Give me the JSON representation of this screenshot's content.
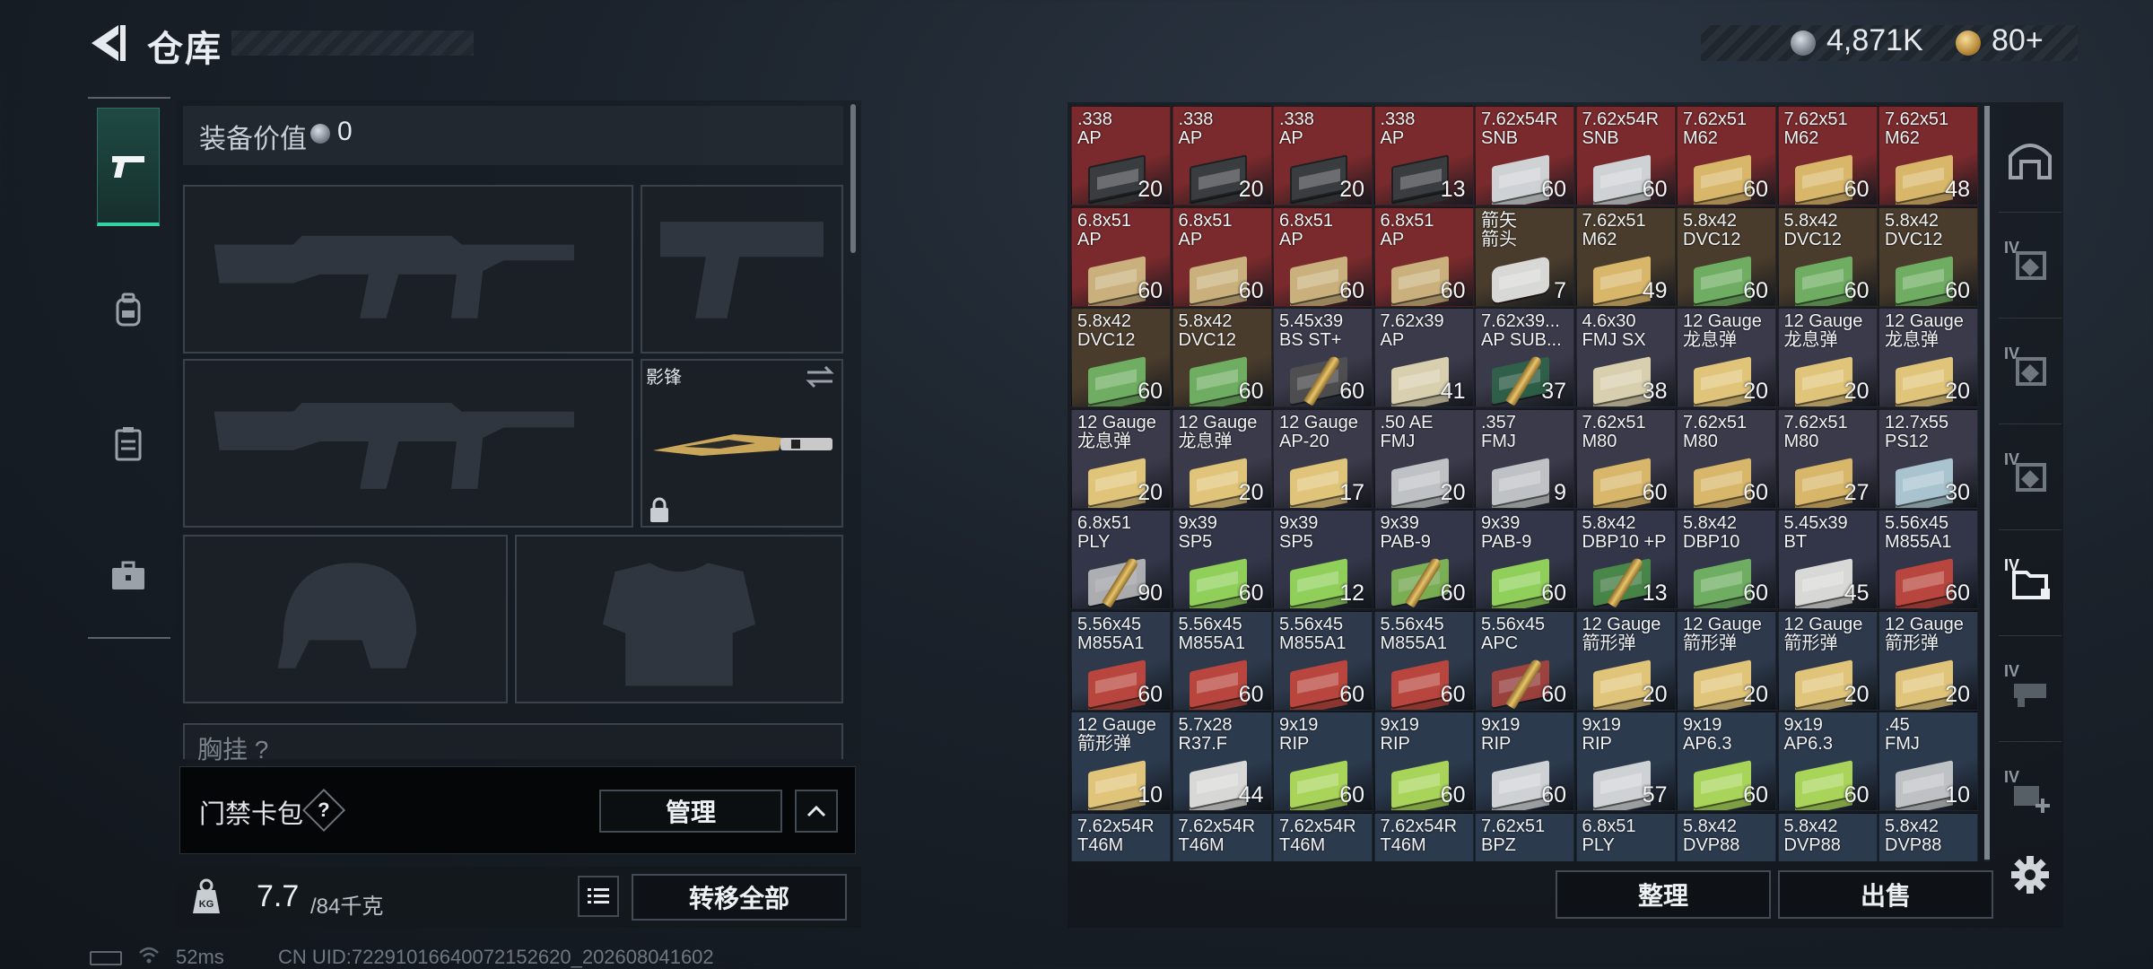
{
  "header": {
    "title": "仓库",
    "currencies": [
      {
        "name": "silver-coin-icon",
        "value": "4,871K"
      },
      {
        "name": "gold-coin-icon",
        "value": "80+"
      }
    ]
  },
  "loadout": {
    "value_label": "装备价值",
    "value": "0",
    "melee_name": "影锋",
    "chest_label": "胸挂 ?",
    "tabs": [
      "weapons-tab",
      "backpack-tab",
      "vest-tab",
      "case-tab"
    ]
  },
  "keycard": {
    "label": "门禁卡包",
    "help": "?",
    "manage": "管理"
  },
  "capacity": {
    "weight": "7.7",
    "max": "/84千克",
    "transfer_all": "转移全部",
    "weight_icon_label": "KG"
  },
  "status": {
    "ping": "52ms",
    "uid": "CN UID:72291016640072152620_202608041602"
  },
  "inventory": {
    "sort": "整理",
    "sell": "出售",
    "right_tabs": [
      "inventory-top-icon",
      "IV",
      "IV",
      "IV",
      "IV",
      "IV",
      "IV"
    ],
    "items": [
      {
        "n": ".338\nAP",
        "c": "20",
        "bg": "#7a2a2c",
        "art": "case",
        "col": "#3a3d40"
      },
      {
        "n": ".338\nAP",
        "c": "20",
        "bg": "#7a2a2c",
        "art": "case",
        "col": "#3a3d40"
      },
      {
        "n": ".338\nAP",
        "c": "20",
        "bg": "#7a2a2c",
        "art": "case",
        "col": "#3a3d40"
      },
      {
        "n": ".338\nAP",
        "c": "13",
        "bg": "#7a2a2c",
        "art": "case",
        "col": "#3a3d40"
      },
      {
        "n": "7.62x54R\nSNB",
        "c": "60",
        "bg": "#7a2a2c",
        "art": "box",
        "col": "#cfd2d4"
      },
      {
        "n": "7.62x54R\nSNB",
        "c": "60",
        "bg": "#7a2a2c",
        "art": "box",
        "col": "#cfd2d4"
      },
      {
        "n": "7.62x51\nM62",
        "c": "60",
        "bg": "#7a2a2c",
        "art": "box",
        "col": "#d9b76a"
      },
      {
        "n": "7.62x51\nM62",
        "c": "60",
        "bg": "#7a2a2c",
        "art": "box",
        "col": "#d9b76a"
      },
      {
        "n": "7.62x51\nM62",
        "c": "48",
        "bg": "#7a2a2c",
        "art": "box",
        "col": "#d9b76a"
      },
      {
        "n": "6.8x51\nAP",
        "c": "60",
        "bg": "#7a2a2c",
        "art": "box",
        "col": "#c9b07c"
      },
      {
        "n": "6.8x51\nAP",
        "c": "60",
        "bg": "#7a2a2c",
        "art": "box",
        "col": "#c9b07c"
      },
      {
        "n": "6.8x51\nAP",
        "c": "60",
        "bg": "#7a2a2c",
        "art": "box",
        "col": "#c9b07c"
      },
      {
        "n": "6.8x51\nAP",
        "c": "60",
        "bg": "#7a2a2c",
        "art": "box",
        "col": "#c9b07c"
      },
      {
        "n": "箭矢\n箭头",
        "c": "7",
        "bg": "#4a3c2c",
        "art": "tin",
        "col": "#d8d8d6"
      },
      {
        "n": "7.62x51\nM62",
        "c": "49",
        "bg": "#4a3c2c",
        "art": "box",
        "col": "#d9b76a"
      },
      {
        "n": "5.8x42\nDVC12",
        "c": "60",
        "bg": "#4a3c2c",
        "art": "box",
        "col": "#6fae62"
      },
      {
        "n": "5.8x42\nDVC12",
        "c": "60",
        "bg": "#4a3c2c",
        "art": "box",
        "col": "#6fae62"
      },
      {
        "n": "5.8x42\nDVC12",
        "c": "60",
        "bg": "#4a3c2c",
        "art": "box",
        "col": "#6fae62"
      },
      {
        "n": "5.8x42\nDVC12",
        "c": "60",
        "bg": "#4a3c2c",
        "art": "box",
        "col": "#6fae62"
      },
      {
        "n": "5.8x42\nDVC12",
        "c": "60",
        "bg": "#4a3c2c",
        "art": "box",
        "col": "#6fae62"
      },
      {
        "n": "5.45x39\nBS ST+",
        "c": "60",
        "bg": "#3b3a4a",
        "art": "bullet",
        "col": "#555"
      },
      {
        "n": "7.62x39\nAP",
        "c": "41",
        "bg": "#3b3a4a",
        "art": "box",
        "col": "#d8cfae"
      },
      {
        "n": "7.62x39...\nAP SUB...",
        "c": "37",
        "bg": "#3b3a4a",
        "art": "bullet",
        "col": "#2e6a4a"
      },
      {
        "n": "4.6x30\nFMJ SX",
        "c": "38",
        "bg": "#3b3a4a",
        "art": "box",
        "col": "#d8cfae"
      },
      {
        "n": "12 Gauge\n龙息弹",
        "c": "20",
        "bg": "#3b3a4a",
        "art": "box",
        "col": "#e0c47a"
      },
      {
        "n": "12 Gauge\n龙息弹",
        "c": "20",
        "bg": "#3b3a4a",
        "art": "box",
        "col": "#e0c47a"
      },
      {
        "n": "12 Gauge\n龙息弹",
        "c": "20",
        "bg": "#3b3a4a",
        "art": "box",
        "col": "#e0c47a"
      },
      {
        "n": "12 Gauge\n龙息弹",
        "c": "20",
        "bg": "#3b3a4a",
        "art": "box",
        "col": "#e0c47a"
      },
      {
        "n": "12 Gauge\n龙息弹",
        "c": "20",
        "bg": "#3b3a4a",
        "art": "box",
        "col": "#e0c47a"
      },
      {
        "n": "12 Gauge\nAP-20",
        "c": "17",
        "bg": "#3b3a4a",
        "art": "box",
        "col": "#e0c47a"
      },
      {
        "n": ".50 AE\nFMJ",
        "c": "20",
        "bg": "#3b3a4a",
        "art": "box",
        "col": "#bfc2c4"
      },
      {
        "n": ".357\nFMJ",
        "c": "9",
        "bg": "#3b3a4a",
        "art": "box",
        "col": "#bfc2c4"
      },
      {
        "n": "7.62x51\nM80",
        "c": "60",
        "bg": "#3b3a4a",
        "art": "box",
        "col": "#d9b76a"
      },
      {
        "n": "7.62x51\nM80",
        "c": "60",
        "bg": "#3b3a4a",
        "art": "box",
        "col": "#d9b76a"
      },
      {
        "n": "7.62x51\nM80",
        "c": "27",
        "bg": "#3b3a4a",
        "art": "box",
        "col": "#d9b76a"
      },
      {
        "n": "12.7x55\nPS12",
        "c": "30",
        "bg": "#3b3a4a",
        "art": "box",
        "col": "#a9c4cf"
      },
      {
        "n": "6.8x51\nPLY",
        "c": "90",
        "bg": "#323648",
        "art": "bullet",
        "col": "#ccc"
      },
      {
        "n": "9x39\nSP5",
        "c": "60",
        "bg": "#323648",
        "art": "box",
        "col": "#8fcf5a"
      },
      {
        "n": "9x39\nSP5",
        "c": "12",
        "bg": "#323648",
        "art": "box",
        "col": "#8fcf5a"
      },
      {
        "n": "9x39\nPAB-9",
        "c": "60",
        "bg": "#323648",
        "art": "bullet",
        "col": "#8fcf5a"
      },
      {
        "n": "9x39\nPAB-9",
        "c": "60",
        "bg": "#323648",
        "art": "box",
        "col": "#8fcf5a"
      },
      {
        "n": "5.8x42\nDBP10 +P",
        "c": "13",
        "bg": "#323648",
        "art": "bullet",
        "col": "#4f9a4a"
      },
      {
        "n": "5.8x42\nDBP10",
        "c": "60",
        "bg": "#323648",
        "art": "box",
        "col": "#6fae62"
      },
      {
        "n": "5.45x39\nBT",
        "c": "45",
        "bg": "#323648",
        "art": "box",
        "col": "#d8d8d6"
      },
      {
        "n": "5.56x45\nM855A1",
        "c": "60",
        "bg": "#323648",
        "art": "box",
        "col": "#b8463e"
      },
      {
        "n": "5.56x45\nM855A1",
        "c": "60",
        "bg": "#2e3a4c",
        "art": "box",
        "col": "#b8463e"
      },
      {
        "n": "5.56x45\nM855A1",
        "c": "60",
        "bg": "#2e3a4c",
        "art": "box",
        "col": "#b8463e"
      },
      {
        "n": "5.56x45\nM855A1",
        "c": "60",
        "bg": "#2e3a4c",
        "art": "box",
        "col": "#b8463e"
      },
      {
        "n": "5.56x45\nM855A1",
        "c": "60",
        "bg": "#2e3a4c",
        "art": "box",
        "col": "#b8463e"
      },
      {
        "n": "5.56x45\nAPC",
        "c": "60",
        "bg": "#2e3a4c",
        "art": "bullet",
        "col": "#b8463e"
      },
      {
        "n": "12 Gauge\n箭形弹",
        "c": "20",
        "bg": "#2e3a4c",
        "art": "box",
        "col": "#e0c47a"
      },
      {
        "n": "12 Gauge\n箭形弹",
        "c": "20",
        "bg": "#2e3a4c",
        "art": "box",
        "col": "#e0c47a"
      },
      {
        "n": "12 Gauge\n箭形弹",
        "c": "20",
        "bg": "#2e3a4c",
        "art": "box",
        "col": "#e0c47a"
      },
      {
        "n": "12 Gauge\n箭形弹",
        "c": "20",
        "bg": "#2e3a4c",
        "art": "box",
        "col": "#e0c47a"
      },
      {
        "n": "12 Gauge\n箭形弹",
        "c": "10",
        "bg": "#2c3a4e",
        "art": "box",
        "col": "#e0c47a"
      },
      {
        "n": "5.7x28\nR37.F",
        "c": "44",
        "bg": "#2c3a4e",
        "art": "box",
        "col": "#d8d8d6"
      },
      {
        "n": "9x19\nRIP",
        "c": "60",
        "bg": "#2c3a4e",
        "art": "box",
        "col": "#a9d45a"
      },
      {
        "n": "9x19\nRIP",
        "c": "60",
        "bg": "#2c3a4e",
        "art": "box",
        "col": "#a9d45a"
      },
      {
        "n": "9x19\nRIP",
        "c": "60",
        "bg": "#2c3a4e",
        "art": "box",
        "col": "#cfd2d4"
      },
      {
        "n": "9x19\nRIP",
        "c": "57",
        "bg": "#2c3a4e",
        "art": "box",
        "col": "#cfd2d4"
      },
      {
        "n": "9x19\nAP6.3",
        "c": "60",
        "bg": "#2c3a4e",
        "art": "box",
        "col": "#a9d45a"
      },
      {
        "n": "9x19\nAP6.3",
        "c": "60",
        "bg": "#2c3a4e",
        "art": "box",
        "col": "#a9d45a"
      },
      {
        "n": ".45\nFMJ",
        "c": "10",
        "bg": "#2c3a4e",
        "art": "box",
        "col": "#bfc2c4"
      },
      {
        "n": "7.62x54R\nT46M",
        "c": "",
        "bg": "#2c3a4e",
        "art": "box",
        "col": "#cfd2d4"
      },
      {
        "n": "7.62x54R\nT46M",
        "c": "",
        "bg": "#2c3a4e",
        "art": "box",
        "col": "#cfd2d4"
      },
      {
        "n": "7.62x54R\nT46M",
        "c": "",
        "bg": "#2c3a4e",
        "art": "box",
        "col": "#cfd2d4"
      },
      {
        "n": "7.62x54R\nT46M",
        "c": "",
        "bg": "#2c3a4e",
        "art": "box",
        "col": "#cfd2d4"
      },
      {
        "n": "7.62x51\nBPZ",
        "c": "",
        "bg": "#2c3a4e",
        "art": "box",
        "col": "#d9b76a"
      },
      {
        "n": "6.8x51\nPLY",
        "c": "",
        "bg": "#2c3a4e",
        "art": "bullet",
        "col": "#ccc"
      },
      {
        "n": "5.8x42\nDVP88",
        "c": "",
        "bg": "#2c3a4e",
        "art": "box",
        "col": "#6fae62"
      },
      {
        "n": "5.8x42\nDVP88",
        "c": "",
        "bg": "#2c3a4e",
        "art": "box",
        "col": "#6fae62"
      },
      {
        "n": "5.8x42\nDVP88",
        "c": "",
        "bg": "#2c3a4e",
        "art": "box",
        "col": "#6fae62"
      }
    ]
  }
}
